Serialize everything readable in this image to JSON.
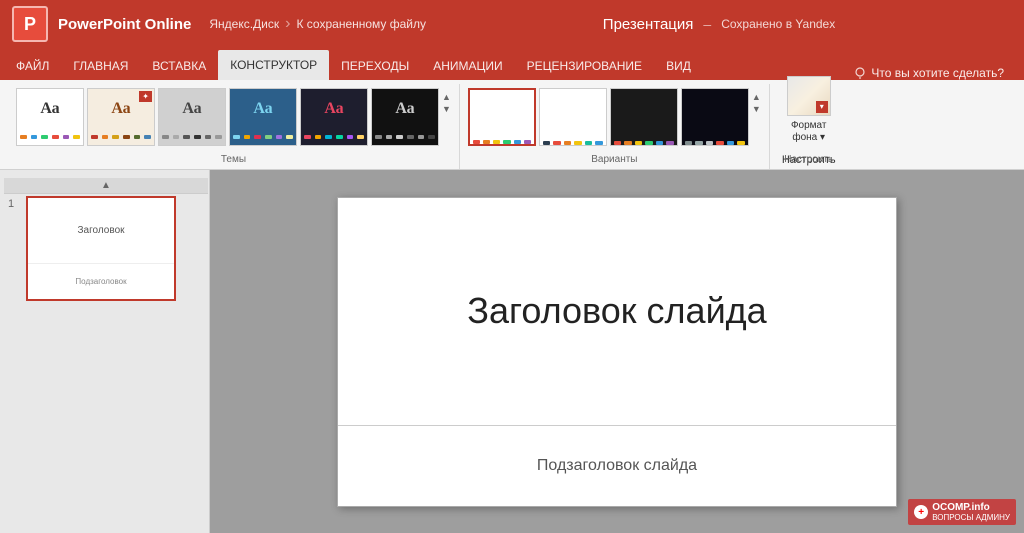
{
  "titleBar": {
    "logoText": "P",
    "appName": "PowerPoint Online",
    "disk": "Яндекс.Диск",
    "separator1": "›",
    "filePath": "К сохраненному файлу",
    "presentationTitle": "Презентация",
    "separator2": "–",
    "savedStatus": "Сохранено в Yandex"
  },
  "ribbonTabs": [
    {
      "label": "ФАЙЛ",
      "active": false
    },
    {
      "label": "ГЛАВНАЯ",
      "active": false
    },
    {
      "label": "ВСТАВКА",
      "active": false
    },
    {
      "label": "КОНСТРУКТОР",
      "active": true
    },
    {
      "label": "ПЕРЕХОДЫ",
      "active": false
    },
    {
      "label": "АНИМАЦИИ",
      "active": false
    },
    {
      "label": "РЕЦЕНЗИРОВАНИЕ",
      "active": false
    },
    {
      "label": "ВИД",
      "active": false
    }
  ],
  "ribbonSearch": "Что вы хотите сделать?",
  "ribbonGroups": {
    "themes": {
      "label": "Темы",
      "items": [
        {
          "id": "t-white",
          "text": "Аа",
          "selected": false
        },
        {
          "id": "t-orange",
          "text": "Аа",
          "selected": false
        },
        {
          "id": "t-gray",
          "text": "Аа",
          "selected": false
        },
        {
          "id": "t-green",
          "text": "Аа",
          "selected": false
        },
        {
          "id": "t-dark",
          "text": "Аа",
          "selected": false
        },
        {
          "id": "t-black",
          "text": "Аа",
          "selected": false
        }
      ]
    },
    "variants": {
      "label": "Варианты",
      "items": [
        {
          "id": "v1",
          "selected": true
        },
        {
          "id": "v2",
          "selected": false
        },
        {
          "id": "v3",
          "selected": false
        },
        {
          "id": "v4",
          "selected": false
        }
      ]
    },
    "format": {
      "label": "Настроить",
      "bgButton": "Формат\nфона ▾",
      "settingsButton": "Настроить"
    }
  },
  "slides": [
    {
      "number": "1"
    }
  ],
  "slideContent": {
    "title": "Заголовок слайда",
    "subtitle": "Подзаголовок слайда"
  },
  "watermark": {
    "icon": "+",
    "text": "OCOMP.info",
    "subtext": "ВОПРОСЫ АДМИНУ"
  }
}
